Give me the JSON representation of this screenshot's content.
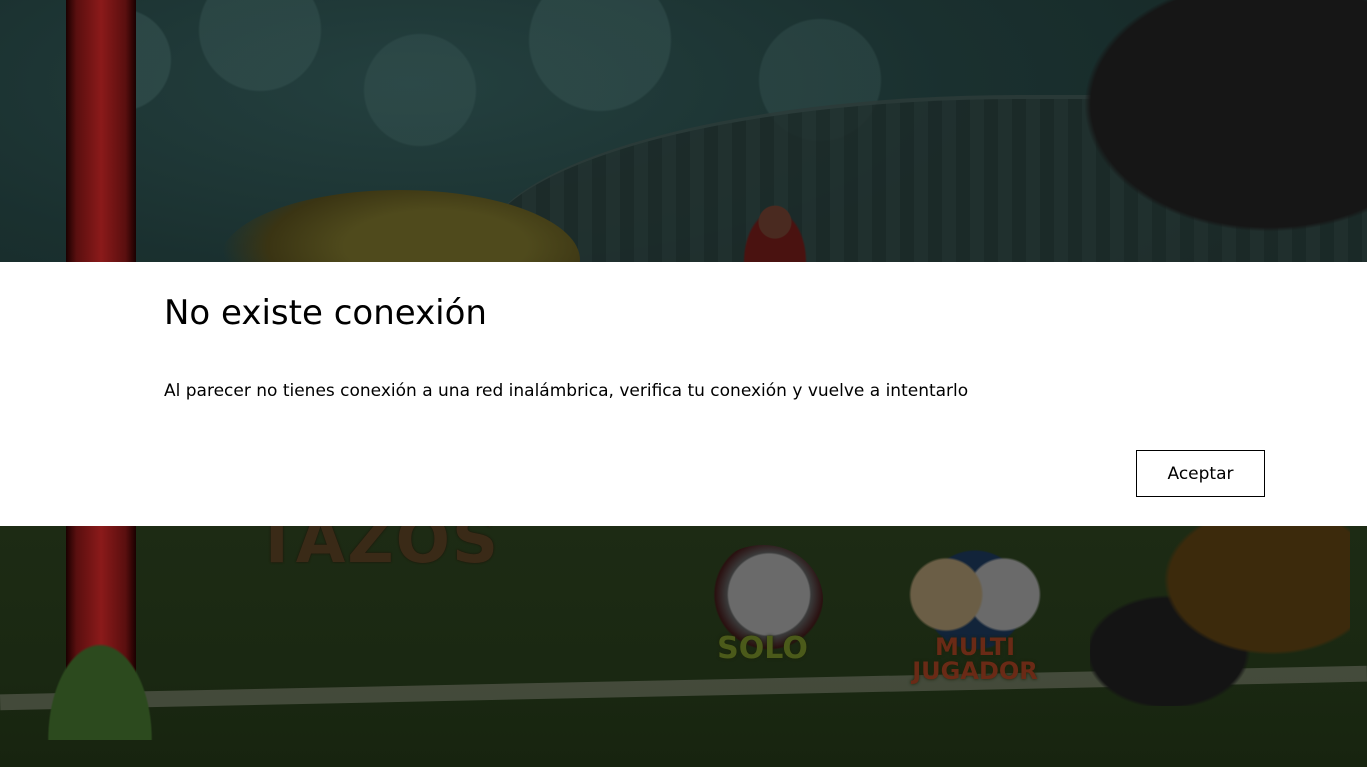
{
  "dialog": {
    "title": "No existe conexión",
    "message": "Al parecer no tienes conexión a una red inalámbrica, verifica tu conexión y vuelve a intentarlo",
    "ok_button": "Aceptar"
  },
  "game_menu": {
    "logo_text": "TAZOS",
    "modes": [
      {
        "label": "SOLO"
      },
      {
        "label_line1": "MULTI",
        "label_line2": "JUGADOR"
      }
    ]
  },
  "colors": {
    "dialog_background": "#ffffff",
    "overlay_dim": "#0b1a16",
    "button_border": "#000000"
  }
}
